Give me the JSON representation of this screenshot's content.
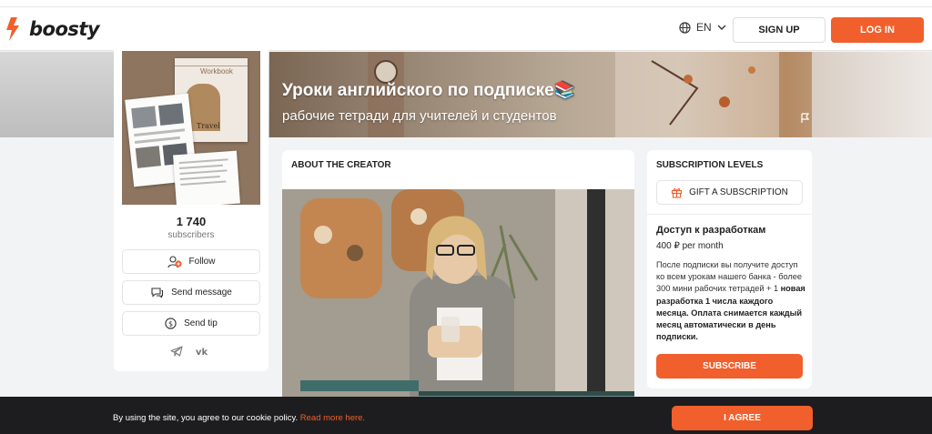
{
  "header": {
    "logo_text": "boosty",
    "language": "EN",
    "signup_label": "SIGN UP",
    "login_label": "LOG IN"
  },
  "cover": {
    "title": "Уроки английского по подписке📚",
    "subtitle": "рабочие тетради для учителей и студентов"
  },
  "profile": {
    "avatar_text_1": "Workbook",
    "avatar_text_2": "Travel",
    "subscribers_count": "1 740",
    "subscribers_label": "subscribers",
    "follow_label": "Follow",
    "message_label": "Send message",
    "tip_label": "Send tip"
  },
  "about": {
    "heading": "ABOUT THE CREATOR"
  },
  "subscription": {
    "heading": "SUBSCRIPTION LEVELS",
    "gift_label": "GIFT A SUBSCRIPTION",
    "tier_title": "Доступ к разработкам",
    "tier_price": "400 ₽ per month",
    "tier_desc_plain": "После подписки вы получите доступ ко всем урокам нашего банка - более 300 мини рабочих тетрадей + 1 ",
    "tier_desc_bold": "новая разработка 1 числа каждого месяца. Оплата снимается каждый месяц автоматически в день подписки.",
    "subscribe_label": "SUBSCRIBE"
  },
  "cookie": {
    "text": "By using the site, you agree to our cookie policy. ",
    "link": "Read more here.",
    "agree_label": "I AGREE"
  },
  "colors": {
    "accent": "#f15f2c",
    "cookie_bg": "#1d1d1f"
  }
}
